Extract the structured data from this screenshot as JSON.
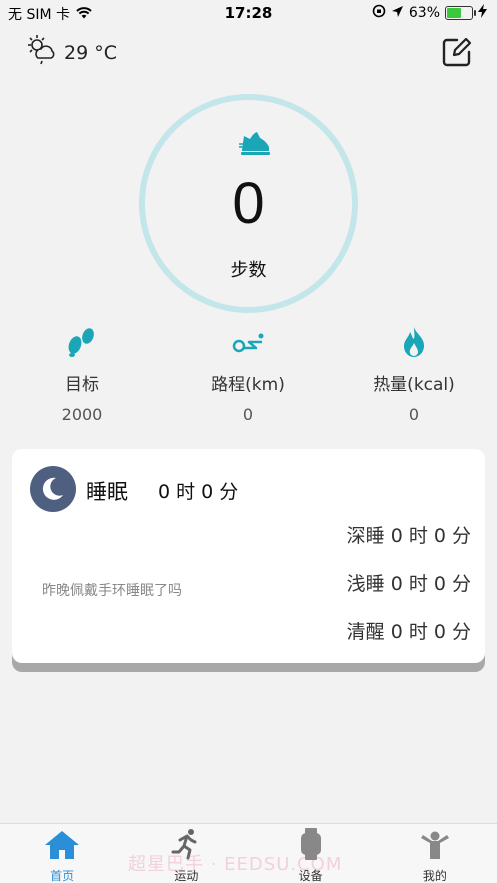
{
  "status_bar": {
    "carrier": "无 SIM 卡",
    "time": "17:28",
    "battery_percent": "63%",
    "battery_level": 0.63
  },
  "weather": {
    "temperature": "29 °C",
    "icon": "partly-cloudy-icon"
  },
  "steps": {
    "value": "0",
    "label": "步数"
  },
  "stats": [
    {
      "icon": "footprints-icon",
      "label": "目标",
      "value": "2000"
    },
    {
      "icon": "distance-icon",
      "label": "路程(km)",
      "value": "0"
    },
    {
      "icon": "flame-icon",
      "label": "热量(kcal)",
      "value": "0"
    }
  ],
  "sleep": {
    "title": "睡眠",
    "total": "0 时 0 分",
    "deep": "深睡 0 时 0 分",
    "light": "浅睡 0 时 0 分",
    "awake": "清醒 0 时 0 分",
    "hint": "昨晚佩戴手环睡眠了吗"
  },
  "tabs": [
    {
      "label": "首页",
      "icon": "home-icon",
      "active": true
    },
    {
      "label": "运动",
      "icon": "runner-icon",
      "active": false
    },
    {
      "label": "设备",
      "icon": "watch-icon",
      "active": false
    },
    {
      "label": "我的",
      "icon": "person-icon",
      "active": false
    }
  ],
  "watermark": "超星巴手 · EEDSU.COM",
  "colors": {
    "accent": "#1aa6b7",
    "ring": "#c2e6e9",
    "tab_active": "#2a8fd6",
    "moon": "#4e5f80"
  }
}
